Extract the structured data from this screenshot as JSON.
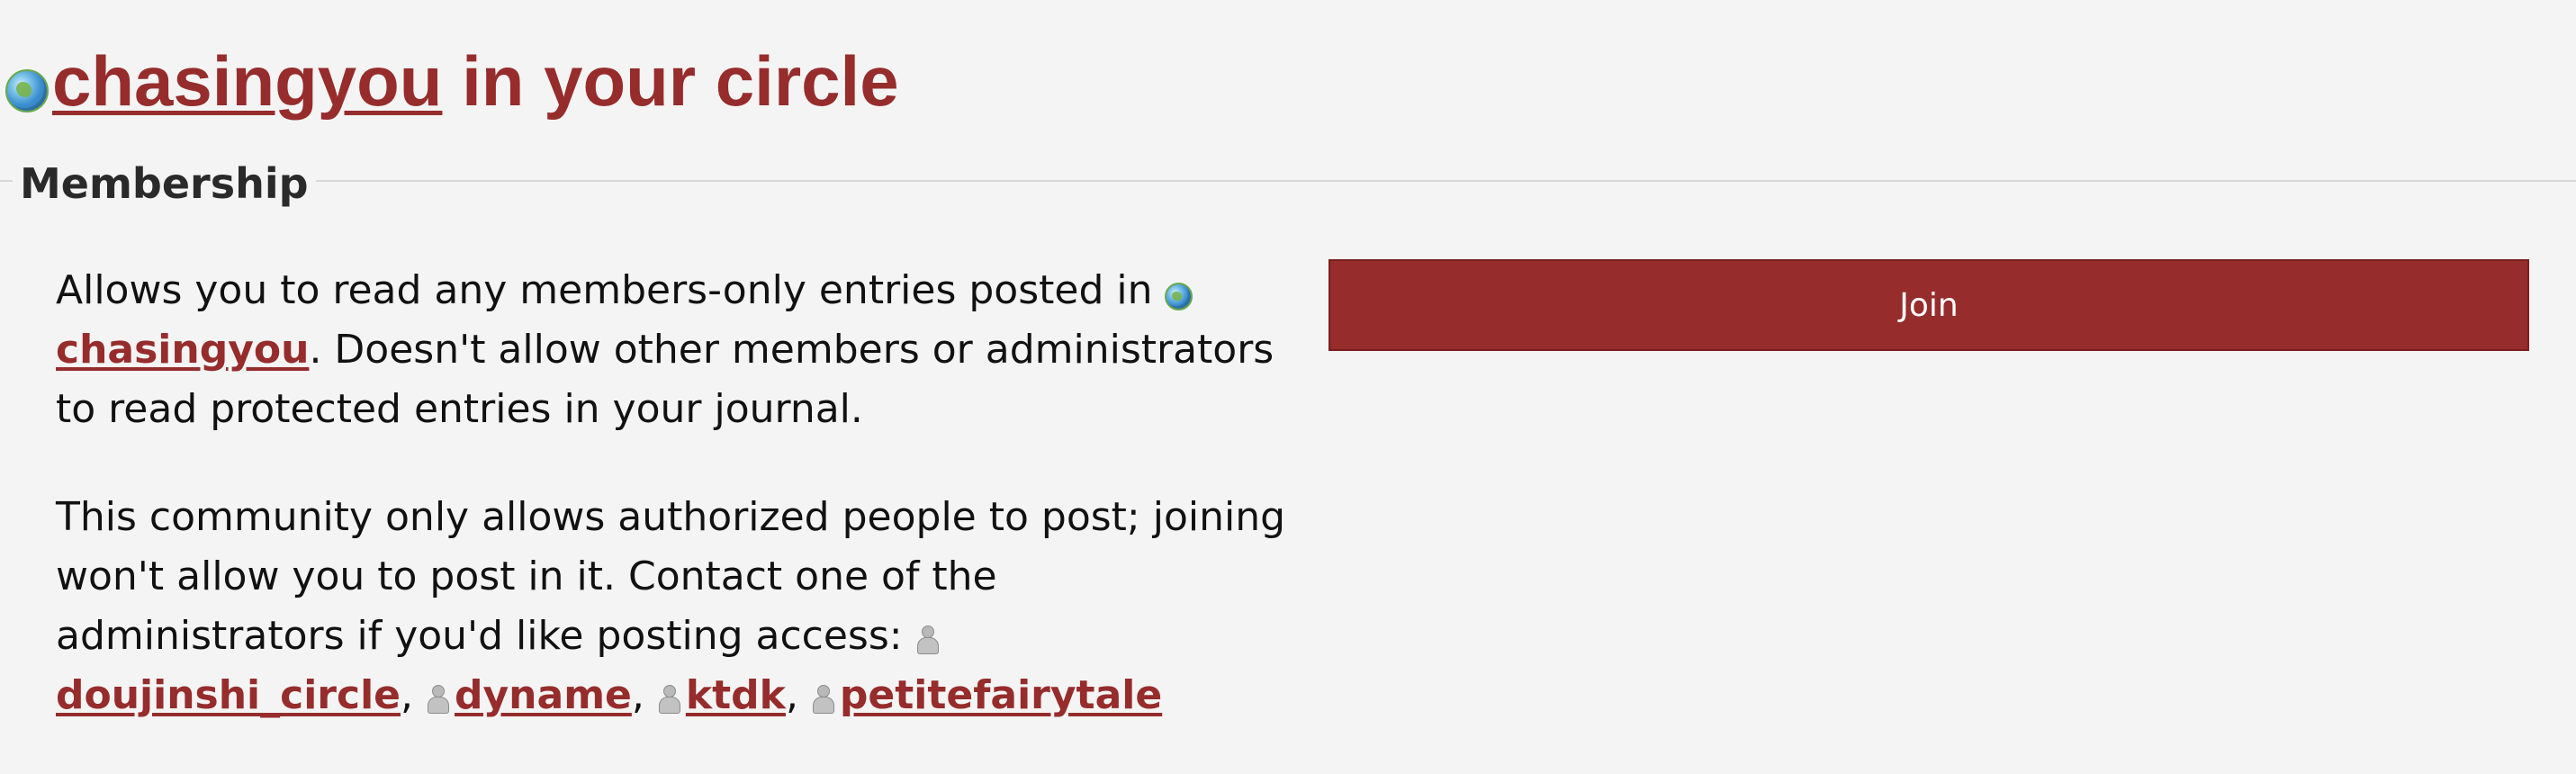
{
  "title": {
    "community_name": "chasingyou",
    "suffix": " in your circle"
  },
  "membership": {
    "heading": "Membership",
    "description_before": "Allows you to read any members-only entries posted in ",
    "community_name": "chasingyou",
    "description_after": ". Doesn't allow other members or administrators to read protected entries in your journal.",
    "posting_notice": "This community only allows authorized people to post; joining won't allow you to post in it. Contact one of the administrators if you'd like posting access:",
    "administrators": [
      "doujinshi_circle",
      "dyname",
      "ktdk",
      "petitefairytale"
    ],
    "separator": ", ",
    "join_label": "Join"
  },
  "icons": {
    "community": "globe-icon",
    "user": "user-icon"
  },
  "colors": {
    "accent": "#962c2c",
    "background": "#f4f4f4"
  }
}
